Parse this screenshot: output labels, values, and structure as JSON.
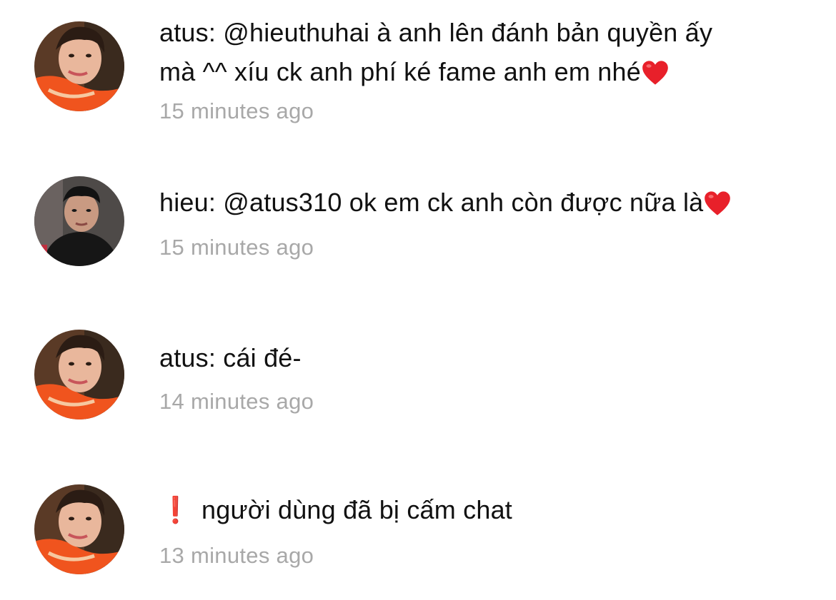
{
  "comments": [
    {
      "author": "atus",
      "separator": ": ",
      "line1": "@hieuthuhai à anh lên đánh bản quyền ấy",
      "line2": "mà ^^ xíu ck anh phí ké fame anh em nhé",
      "trailing_icon": "heart-emoji",
      "time": "15 minutes ago",
      "avatar": "avatar-atus"
    },
    {
      "author": "hieu",
      "separator": ": ",
      "line1": "@atus310 ok em ck anh còn được nữa là",
      "trailing_icon": "heart-emoji",
      "time": "15 minutes ago",
      "avatar": "avatar-hieu"
    },
    {
      "author": "atus",
      "separator": ": ",
      "line1": "cái đé-",
      "time": "14 minutes ago",
      "avatar": "avatar-atus"
    },
    {
      "leading_icon": "exclamation-icon",
      "leading_symbol": "❗",
      "line1": "người dùng đã bị cấm chat",
      "time": "13 minutes ago",
      "avatar": "avatar-atus"
    }
  ],
  "colors": {
    "text": "#111111",
    "timestamp": "#a8a8a8",
    "heart": "#e8202a",
    "exclamation": "#e02020"
  }
}
